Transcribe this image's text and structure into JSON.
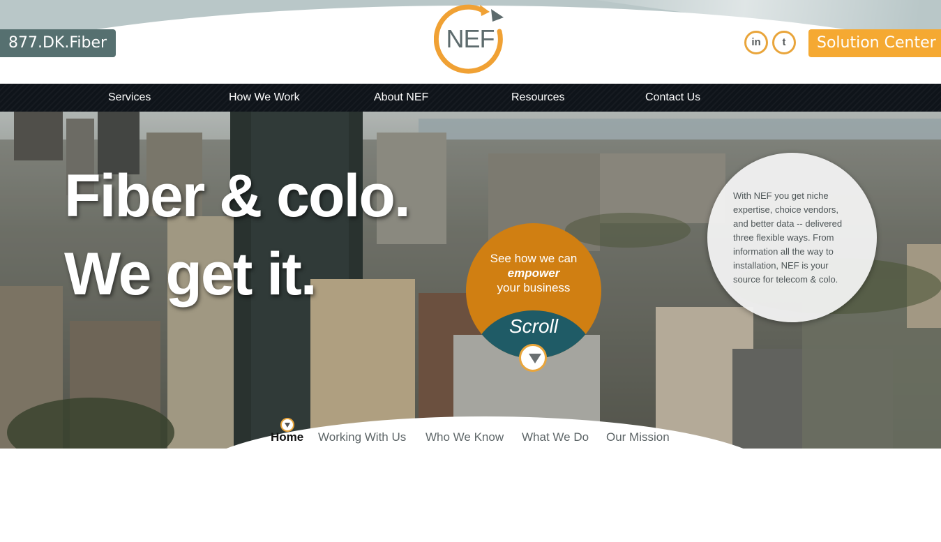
{
  "header": {
    "phone": "877.DK.Fiber",
    "logo_text": "NEF",
    "social": [
      {
        "label": "in",
        "icon": "linkedin-icon"
      },
      {
        "label": "t",
        "icon": "twitter-icon"
      }
    ],
    "solution_center": "Solution Center",
    "accent_color": "#f5a932"
  },
  "nav": {
    "items": [
      {
        "label": "Services"
      },
      {
        "label": "How We Work"
      },
      {
        "label": "About NEF"
      },
      {
        "label": "Resources"
      },
      {
        "label": "Contact Us"
      }
    ]
  },
  "hero": {
    "headline_line1": "Fiber & colo.",
    "headline_line2": "We get it.",
    "cta": {
      "line1": "See how we can",
      "emphasis": "empower",
      "line3": "your business",
      "scroll_label": "Scroll"
    },
    "info": "With NEF you get niche expertise, choice vendors, and better data -- delivered three flexible ways. From information all the way to installation, NEF is your source for telecom & colo."
  },
  "tabs": {
    "items": [
      {
        "label": "Home",
        "active": true
      },
      {
        "label": "Working With Us",
        "active": false
      },
      {
        "label": "Who We Know",
        "active": false
      },
      {
        "label": "What We Do",
        "active": false
      },
      {
        "label": "Our Mission",
        "active": false
      }
    ]
  }
}
